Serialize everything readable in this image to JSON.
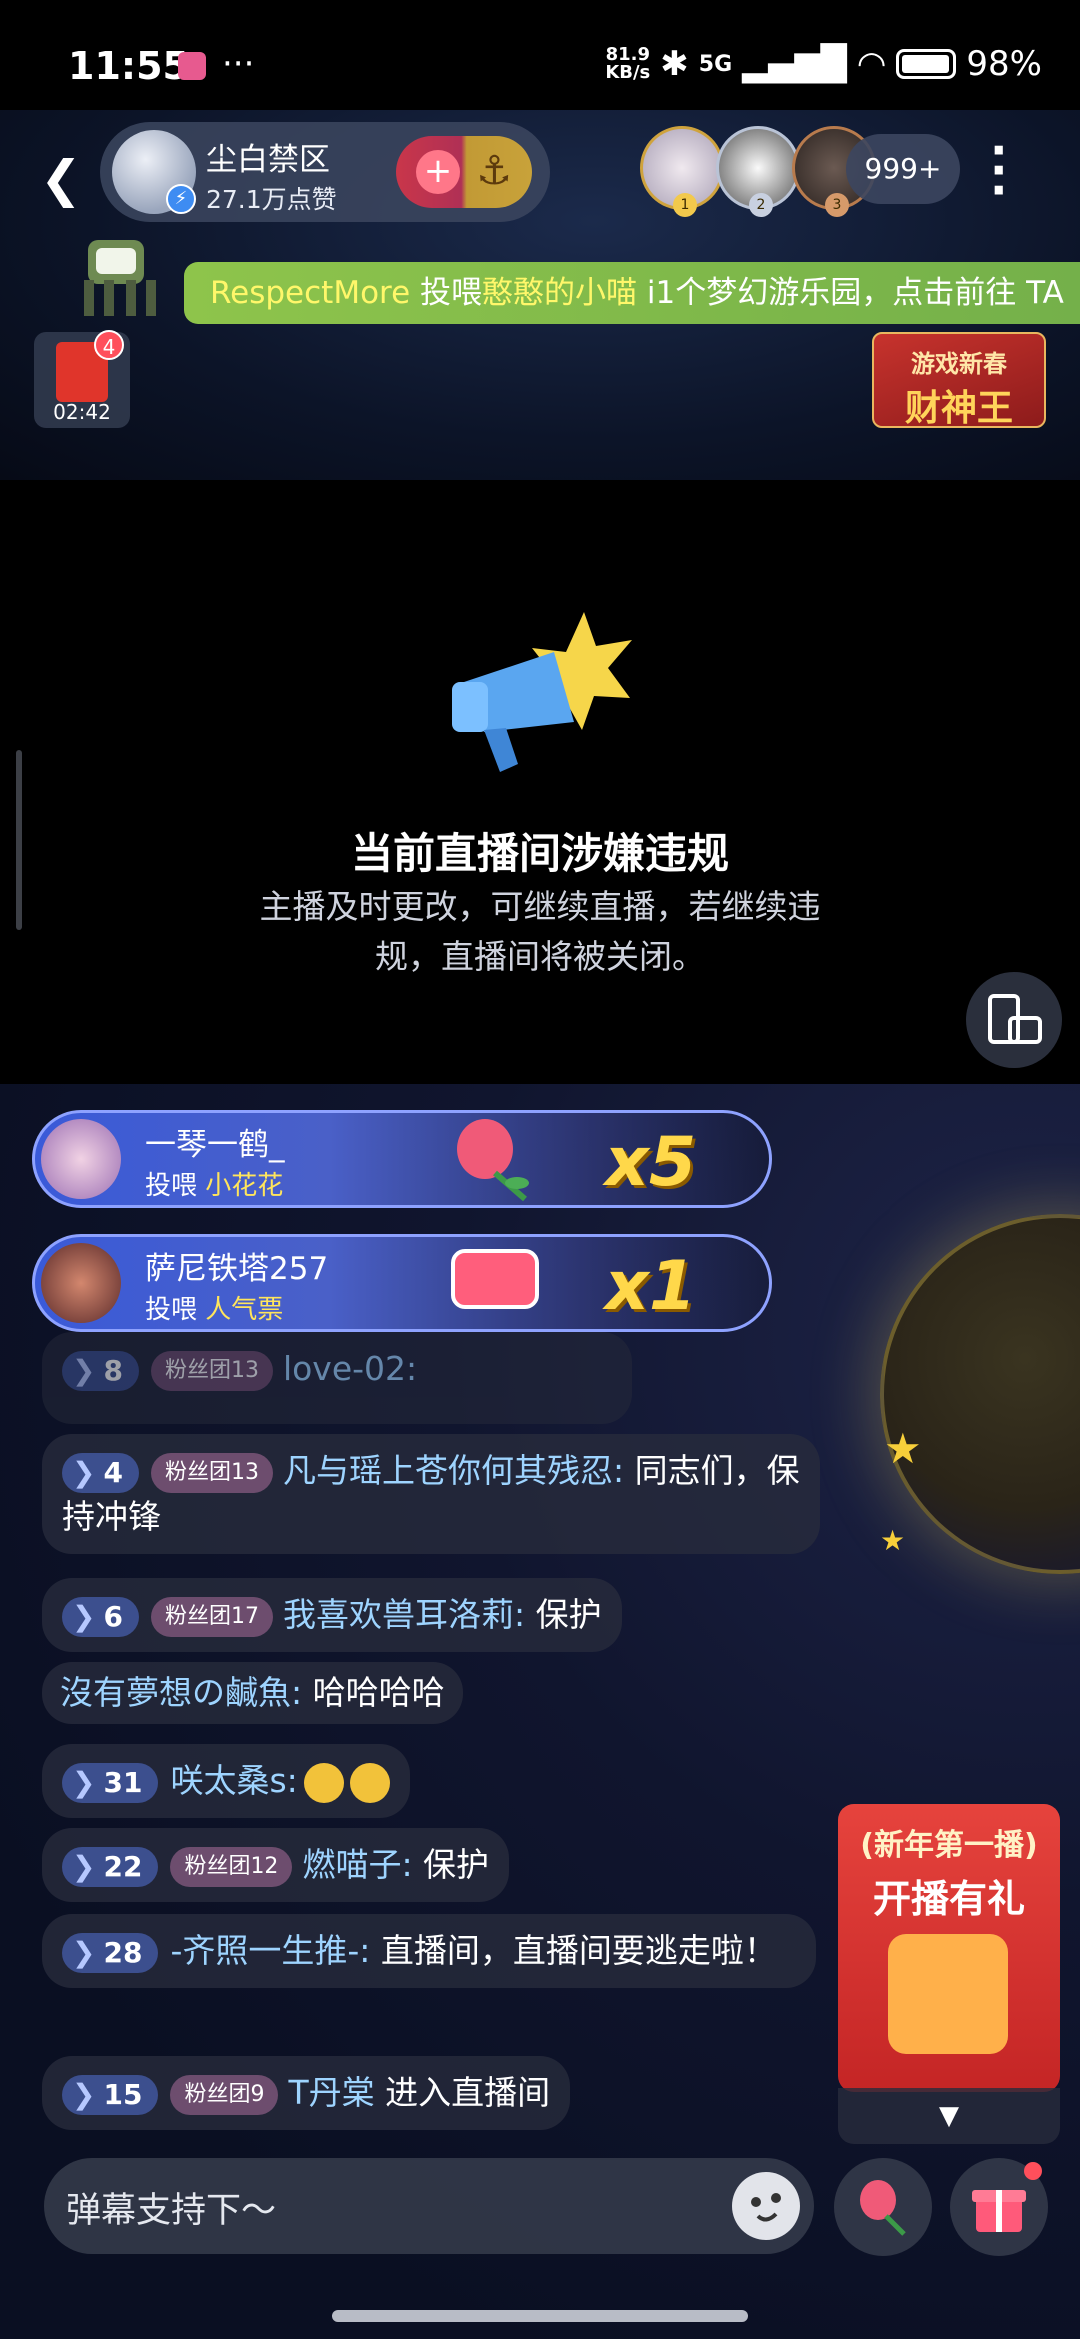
{
  "status_bar": {
    "time": "11:55",
    "more": "···",
    "speed_top": "81.9",
    "speed_bottom": "KB/s",
    "network": "5G",
    "battery": "98%"
  },
  "header": {
    "host_name": "尘白禁区",
    "host_likes": "27.1万点赞",
    "viewer_count": "999+"
  },
  "ticker": {
    "user": "RespectMore",
    "verb": " 投喂",
    "target": "憨憨的小喵",
    "rest": " i1个梦幻游乐园，点击前往 TA"
  },
  "red_packet": {
    "badge": "4",
    "timer": "02:42"
  },
  "promo_fortune": {
    "line1": "游戏新春",
    "line2": "财神王"
  },
  "notice": {
    "title": "当前直播间涉嫌违规",
    "desc": "主播及时更改，可继续直播，若继续违规，直播间将被关闭。"
  },
  "gift_banners": [
    {
      "user": "一琴一鹤_",
      "action": "投喂",
      "gift": "小花花",
      "count": "x5"
    },
    {
      "user": "萨尼铁塔257",
      "action": "投喂",
      "gift": "人气票",
      "count": "x1"
    }
  ],
  "chat": [
    {
      "level": "8",
      "fans": "粉丝团13",
      "user": "love-02:",
      "text": ""
    },
    {
      "level": "4",
      "fans": "粉丝团13",
      "user": "凡与瑶上苍你何其残忍:",
      "text": " 同志们，保持冲锋"
    },
    {
      "level": "6",
      "fans": "粉丝团17",
      "user": "我喜欢兽耳洛莉:",
      "text": " 保护"
    },
    {
      "level": "",
      "fans": "",
      "user": "沒有夢想の鹹魚:",
      "text": " 哈哈哈哈"
    },
    {
      "level": "31",
      "fans": "",
      "user": "咲太桑s:",
      "text": ""
    },
    {
      "level": "22",
      "fans": "粉丝团12",
      "user": "燃喵子:",
      "text": " 保护"
    },
    {
      "level": "28",
      "fans": "",
      "user": "-齐照一生推-:",
      "text": " 直播间，直播间要逃走啦！"
    },
    {
      "level": "15",
      "fans": "粉丝团9",
      "user": "T丹棠",
      "text": " 进入直播间"
    }
  ],
  "promo_newyear": {
    "line1": "(新年第一播)",
    "line2": "开播有礼",
    "arrow": "▼"
  },
  "input": {
    "placeholder": "弹幕支持下～"
  },
  "colors": {
    "ticker_green": "#8ec44b",
    "level_blue": "#3c4f8e",
    "fans_pink": "#6d4d6e",
    "highlight_yellow": "#ffe55c"
  }
}
